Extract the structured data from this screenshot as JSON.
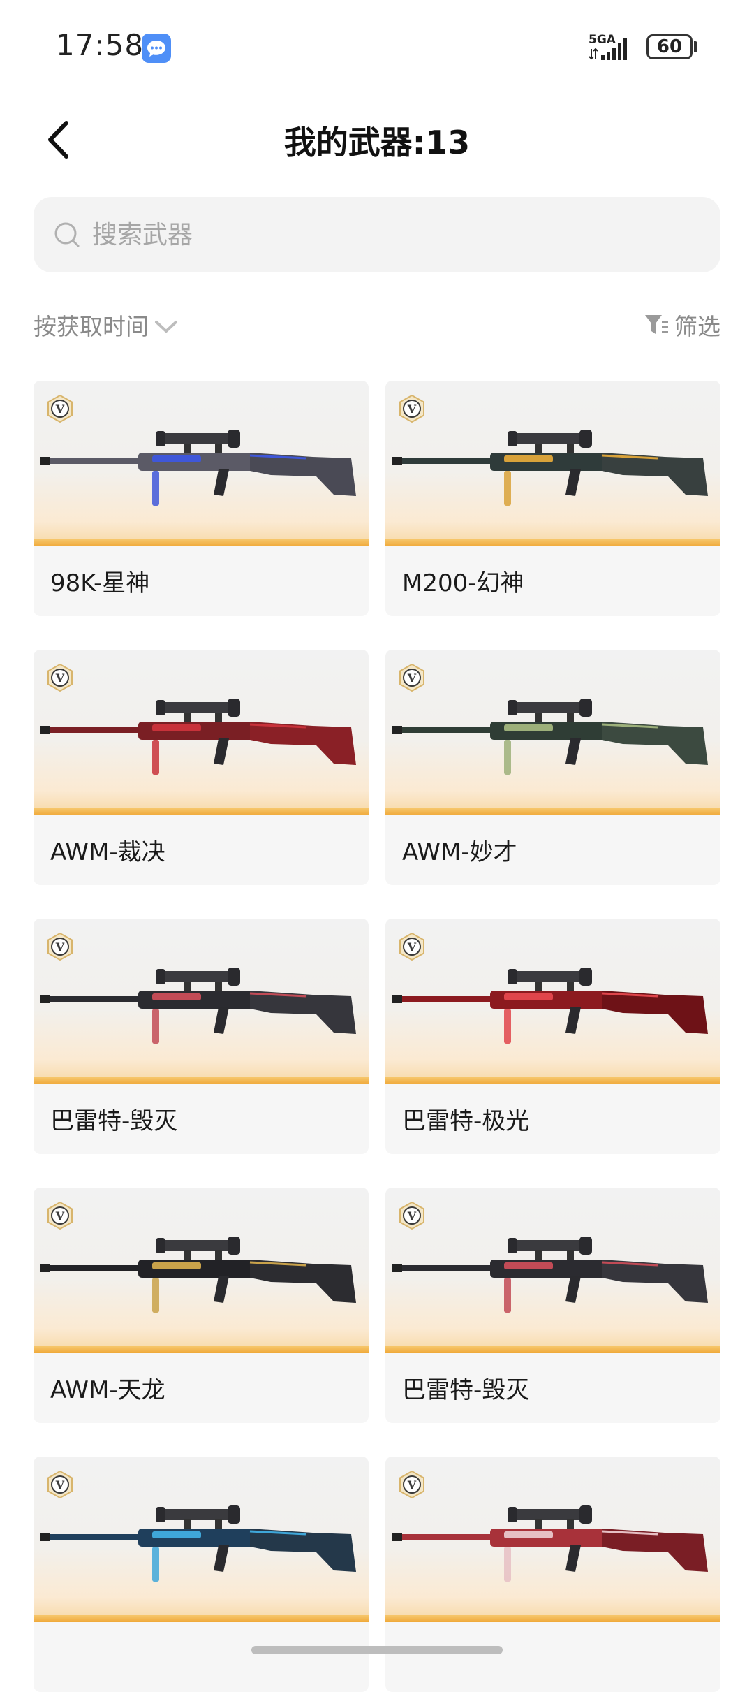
{
  "status_bar": {
    "time": "17:58",
    "network": "5GA",
    "battery": "60"
  },
  "header": {
    "title": "我的武器:13"
  },
  "search": {
    "placeholder": "搜索武器",
    "value": ""
  },
  "sort": {
    "label": "按获取时间"
  },
  "filter": {
    "label": "筛选"
  },
  "weapons": [
    {
      "name": "98K-星神",
      "badge": "V",
      "colors": {
        "body": "#5b5a66",
        "accent": "#3f57d9",
        "stock": "#4a4a55"
      }
    },
    {
      "name": "M200-幻神",
      "badge": "V",
      "colors": {
        "body": "#2f3b3a",
        "accent": "#d9a23a",
        "stock": "#38403f"
      }
    },
    {
      "name": "AWM-裁决",
      "badge": "V",
      "colors": {
        "body": "#7a1f24",
        "accent": "#c8323a",
        "stock": "#8a2026"
      }
    },
    {
      "name": "AWM-妙才",
      "badge": "V",
      "colors": {
        "body": "#2f3d35",
        "accent": "#9db07a",
        "stock": "#3c4a40"
      }
    },
    {
      "name": "巴雷特-毁灭",
      "badge": "V",
      "colors": {
        "body": "#2b2b30",
        "accent": "#c24b56",
        "stock": "#36363c"
      }
    },
    {
      "name": "巴雷特-极光",
      "badge": "V",
      "colors": {
        "body": "#8c1a1f",
        "accent": "#e0454b",
        "stock": "#6e1217"
      }
    },
    {
      "name": "AWM-天龙",
      "badge": "V",
      "colors": {
        "body": "#222226",
        "accent": "#c9a24a",
        "stock": "#2c2c30"
      }
    },
    {
      "name": "巴雷特-毁灭",
      "badge": "V",
      "colors": {
        "body": "#2b2b30",
        "accent": "#c24b56",
        "stock": "#36363c"
      }
    },
    {
      "name": "",
      "badge": "V",
      "colors": {
        "body": "#1f3f5c",
        "accent": "#3fa7d9",
        "stock": "#24384a"
      }
    },
    {
      "name": "",
      "badge": "V",
      "colors": {
        "body": "#a8323a",
        "accent": "#e6c0c4",
        "stock": "#7a1e25"
      }
    }
  ]
}
